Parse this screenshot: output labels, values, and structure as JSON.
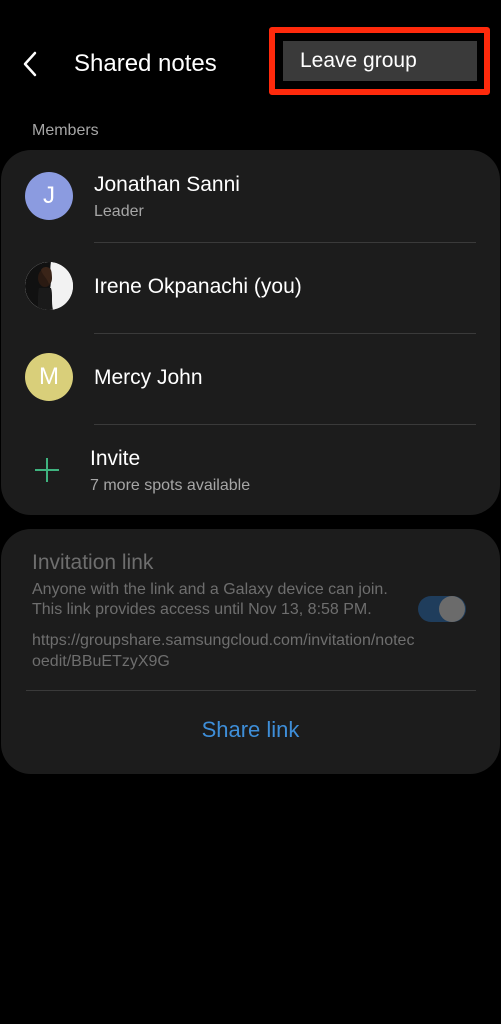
{
  "header": {
    "title": "Shared notes",
    "back_icon": "chevron-left-icon"
  },
  "menu": {
    "leave_group_label": "Leave group",
    "highlight_color": "#ff2a0c"
  },
  "members_section": {
    "label": "Members",
    "members": [
      {
        "initial": "J",
        "name": "Jonathan Sanni",
        "role": "Leader",
        "avatar_color": "#8b9be0"
      },
      {
        "initial": "",
        "name": "Irene Okpanachi (you)",
        "role": "",
        "avatar_color": "#f2f2f2"
      },
      {
        "initial": "M",
        "name": "Mercy John",
        "role": "",
        "avatar_color": "#d9cf7a"
      }
    ],
    "invite": {
      "label": "Invite",
      "sub": "7 more spots available",
      "icon": "plus-icon",
      "icon_color": "#3fb37f"
    }
  },
  "invitation": {
    "title": "Invitation link",
    "description": "Anyone with the link and a Galaxy device can join. This link provides access until Nov 13, 8:58 PM.",
    "url": "https://groupshare.samsungcloud.com/invitation/notecoedit/BBuETzyX9G",
    "toggle_on": true,
    "share_label": "Share link",
    "accent_color": "#3e8ed8"
  }
}
